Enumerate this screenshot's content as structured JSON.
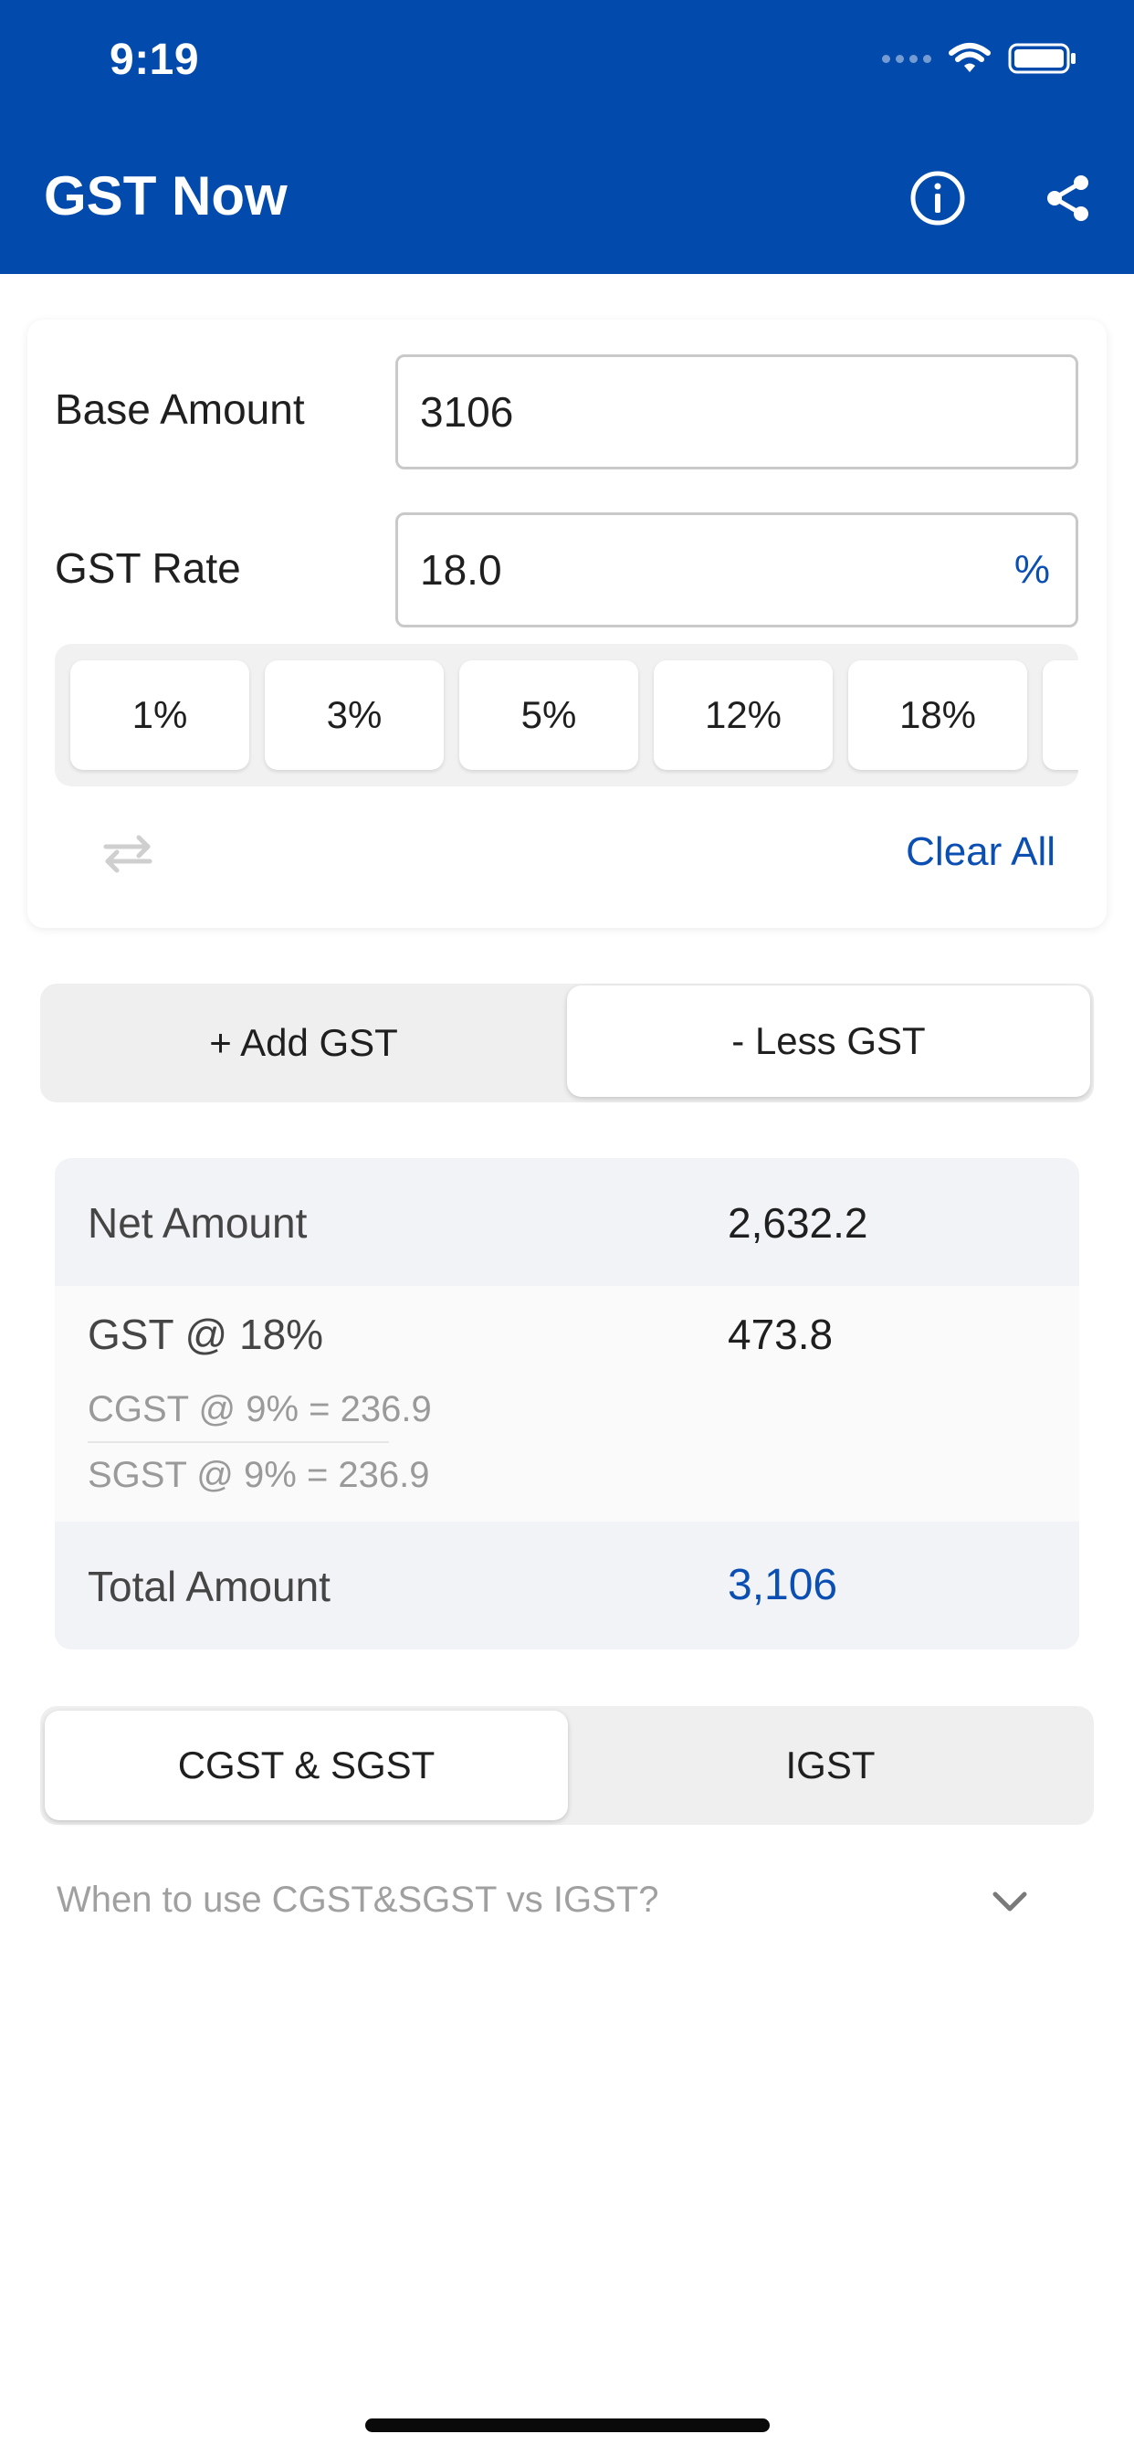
{
  "status_bar": {
    "time": "9:19"
  },
  "app": {
    "title": "GST Now",
    "icons": {
      "info": "info-icon",
      "share": "share-icon"
    }
  },
  "inputs": {
    "base_amount": {
      "label": "Base Amount",
      "value": "3106"
    },
    "gst_rate": {
      "label": "GST Rate",
      "value": "18.0",
      "suffix": "%"
    }
  },
  "rate_chips": [
    "1%",
    "3%",
    "5%",
    "12%",
    "18%"
  ],
  "actions": {
    "clear_all": "Clear All",
    "swap_icon": "swap-icon"
  },
  "mode_toggle": {
    "add": "+ Add GST",
    "less": "- Less GST",
    "selected": "less"
  },
  "results": {
    "net_amount": {
      "label": "Net Amount",
      "value": "2,632.2"
    },
    "gst": {
      "label": "GST @ 18%",
      "value": "473.8",
      "cgst": "CGST @ 9% = 236.9",
      "sgst": "SGST @ 9% = 236.9"
    },
    "total_amount": {
      "label": "Total Amount",
      "value": "3,106"
    }
  },
  "tax_type_toggle": {
    "cgst_sgst": "CGST & SGST",
    "igst": "IGST",
    "selected": "cgst_sgst"
  },
  "faq": {
    "question": "When to use CGST&SGST vs IGST?"
  },
  "colors": {
    "brand": "#034AAD",
    "accent": "#0B4FB3",
    "chip_bg": "#F1F1F1",
    "row_shade": "#F1F3F7"
  }
}
